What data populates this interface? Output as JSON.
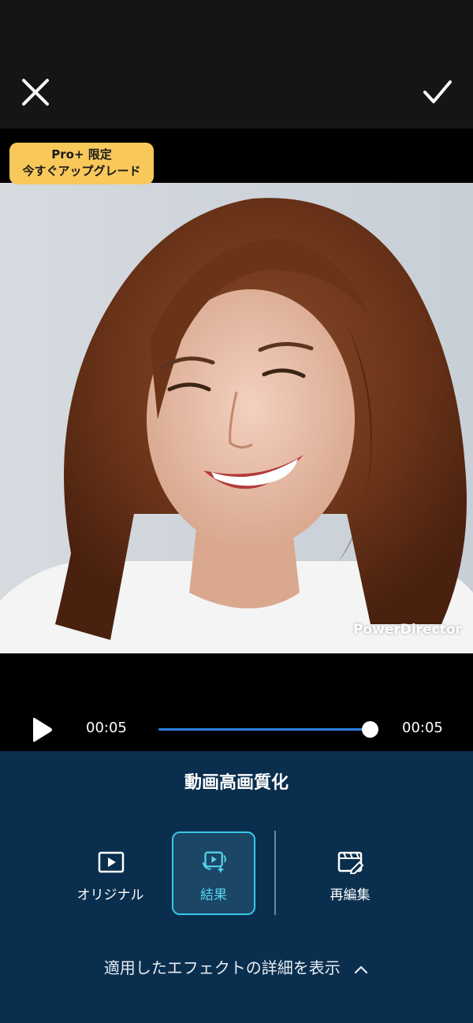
{
  "toolbar": {
    "close_icon": "close-icon",
    "confirm_icon": "check-icon"
  },
  "upgrade_badge": {
    "line1": "Pro+ 限定",
    "line2": "今すぐアップグレード",
    "color": "#f8c85a"
  },
  "preview": {
    "watermark": "PowerDirector"
  },
  "player": {
    "current_time": "00:05",
    "total_time": "00:05",
    "progress": 1.0,
    "accent": "#2d7fe0"
  },
  "panel": {
    "title": "動画高画質化",
    "options": [
      {
        "label": "オリジナル",
        "icon": "play-frame-icon",
        "selected": false
      },
      {
        "label": "結果",
        "icon": "enhanced-video-sparkle-icon",
        "selected": true
      },
      {
        "label": "再編集",
        "icon": "edit-clip-icon",
        "selected": false
      }
    ],
    "selected_color": "#38c8e8",
    "details_link": "適用したエフェクトの詳細を表示",
    "background": "#0a2e4e"
  }
}
